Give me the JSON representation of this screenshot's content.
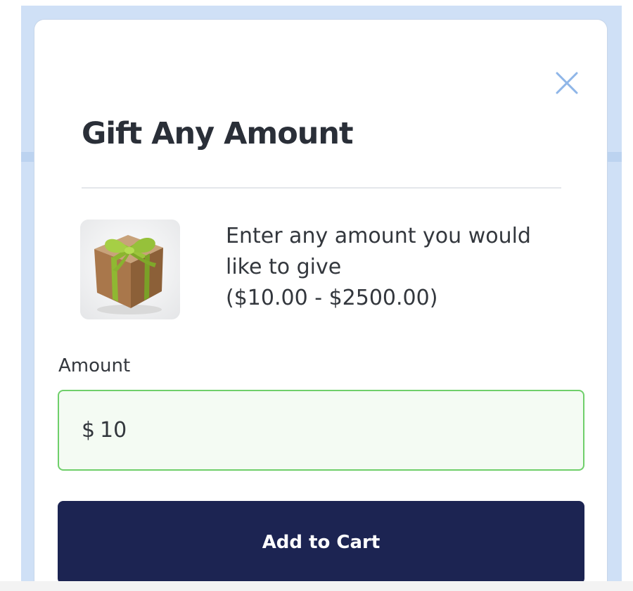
{
  "modal": {
    "title": "Gift Any Amount",
    "close_icon": "close-icon",
    "product_image_icon": "gift-box-icon",
    "description_lines": [
      "Enter any amount you would",
      "like to give",
      "($10.00 - $2500.00)"
    ]
  },
  "amount": {
    "label": "Amount",
    "currency_symbol": "$",
    "value": "10"
  },
  "actions": {
    "add_to_cart_label": "Add to Cart"
  },
  "colors": {
    "primary_button": "#1c2452",
    "input_border_active": "#6fcf6a",
    "close_icon": "#8fb6e8",
    "backdrop": "#cfe0f6"
  }
}
